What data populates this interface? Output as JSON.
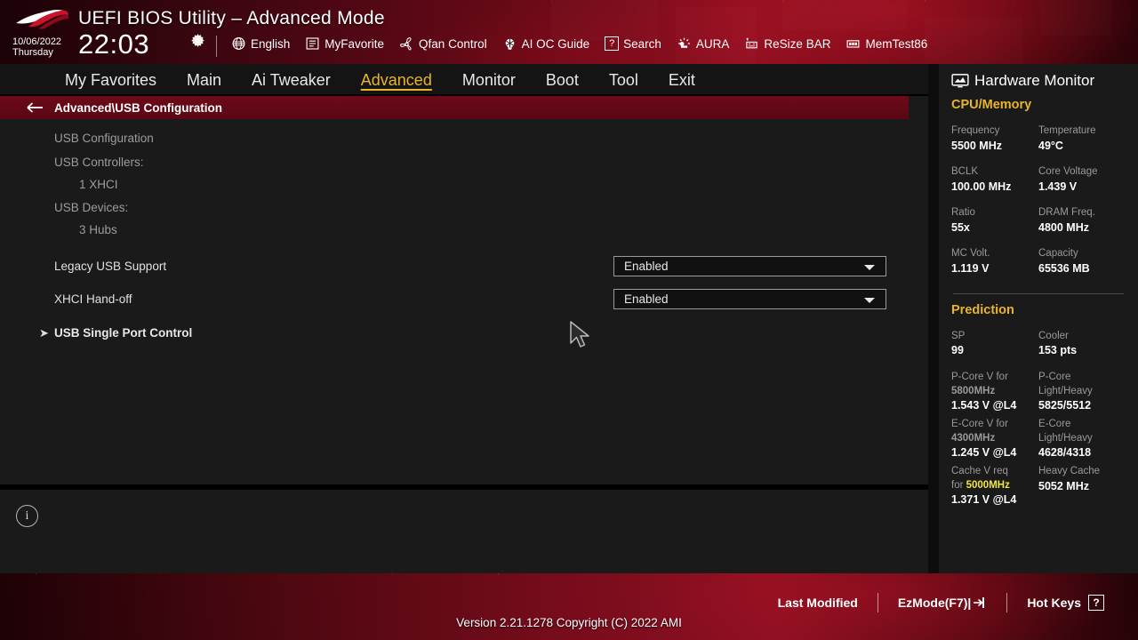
{
  "header": {
    "title": "UEFI BIOS Utility – Advanced Mode",
    "date": "10/06/2022",
    "weekday": "Thursday",
    "time": "22:03",
    "gear_icon": "gear-icon",
    "items": [
      {
        "label": "English",
        "icon": "globe-icon"
      },
      {
        "label": "MyFavorite",
        "icon": "star-list-icon"
      },
      {
        "label": "Qfan Control",
        "icon": "fan-icon"
      },
      {
        "label": "AI OC Guide",
        "icon": "brain-icon"
      },
      {
        "label": "Search",
        "icon": "question-box-icon"
      },
      {
        "label": "AURA",
        "icon": "light-icon"
      },
      {
        "label": "ReSize BAR",
        "icon": "resize-bar-icon"
      },
      {
        "label": "MemTest86",
        "icon": "memory-icon"
      }
    ]
  },
  "nav": {
    "tabs": [
      {
        "label": "My Favorites",
        "active": false
      },
      {
        "label": "Main",
        "active": false
      },
      {
        "label": "Ai Tweaker",
        "active": false
      },
      {
        "label": "Advanced",
        "active": true
      },
      {
        "label": "Monitor",
        "active": false
      },
      {
        "label": "Boot",
        "active": false
      },
      {
        "label": "Tool",
        "active": false
      },
      {
        "label": "Exit",
        "active": false
      }
    ],
    "active_color": "#e8b52a"
  },
  "main": {
    "breadcrumb": "Advanced\\USB Configuration",
    "back_icon": "back-arrow-icon",
    "info_rows": [
      {
        "text": "USB Configuration",
        "indent": 0
      },
      {
        "text": "USB Controllers:",
        "indent": 0
      },
      {
        "text": "1 XHCI",
        "indent": 1
      },
      {
        "text": "USB Devices:",
        "indent": 0
      },
      {
        "text": "3 Hubs",
        "indent": 1
      }
    ],
    "settings": [
      {
        "label": "Legacy USB Support",
        "value": "Enabled"
      },
      {
        "label": "XHCI Hand-off",
        "value": "Enabled"
      }
    ],
    "submenus": [
      {
        "label": "USB Single Port Control",
        "caret": "➤"
      }
    ],
    "info_icon": "i"
  },
  "sidebar": {
    "title": "Hardware Monitor",
    "title_icon": "monitor-icon",
    "sections": [
      {
        "name": "CPU/Memory",
        "pairs": [
          {
            "k1": "Frequency",
            "v1": "5500 MHz",
            "k2": "Temperature",
            "v2": "49°C"
          },
          {
            "k1": "BCLK",
            "v1": "100.00 MHz",
            "k2": "Core Voltage",
            "v2": "1.439 V"
          },
          {
            "k1": "Ratio",
            "v1": "55x",
            "k2": "DRAM Freq.",
            "v2": "4800 MHz"
          },
          {
            "k1": "MC Volt.",
            "v1": "1.119 V",
            "k2": "Capacity",
            "v2": "65536 MB"
          }
        ]
      }
    ],
    "prediction": {
      "name": "Prediction",
      "sp_label": "SP",
      "sp_value": "99",
      "cooler_label": "Cooler",
      "cooler_value": "153 pts",
      "rows": [
        {
          "left_key_a": "P-Core V for",
          "left_key_hl": "5800MHz",
          "left_val": "1.543 V @L4",
          "right_key_a": "P-Core",
          "right_key_b": "Light/Heavy",
          "right_val": "5825/5512"
        },
        {
          "left_key_a": "E-Core V for",
          "left_key_hl": "4300MHz",
          "left_val": "1.245 V @L4",
          "right_key_a": "E-Core",
          "right_key_b": "Light/Heavy",
          "right_val": "4628/4318"
        },
        {
          "left_key_a": "Cache V req",
          "left_key_b": "for",
          "left_key_hl": "5000MHz",
          "left_val": "1.371 V @L4",
          "right_key_a": "Heavy Cache",
          "right_val": "5052 MHz"
        }
      ],
      "highlight_color": "#f2e63c"
    }
  },
  "footer": {
    "last_modified": "Last Modified",
    "ez_mode": "EzMode(F7)|",
    "hot_keys": "Hot Keys",
    "hot_keys_glyph": "?",
    "version": "Version 2.21.1278 Copyright (C) 2022 AMI"
  }
}
